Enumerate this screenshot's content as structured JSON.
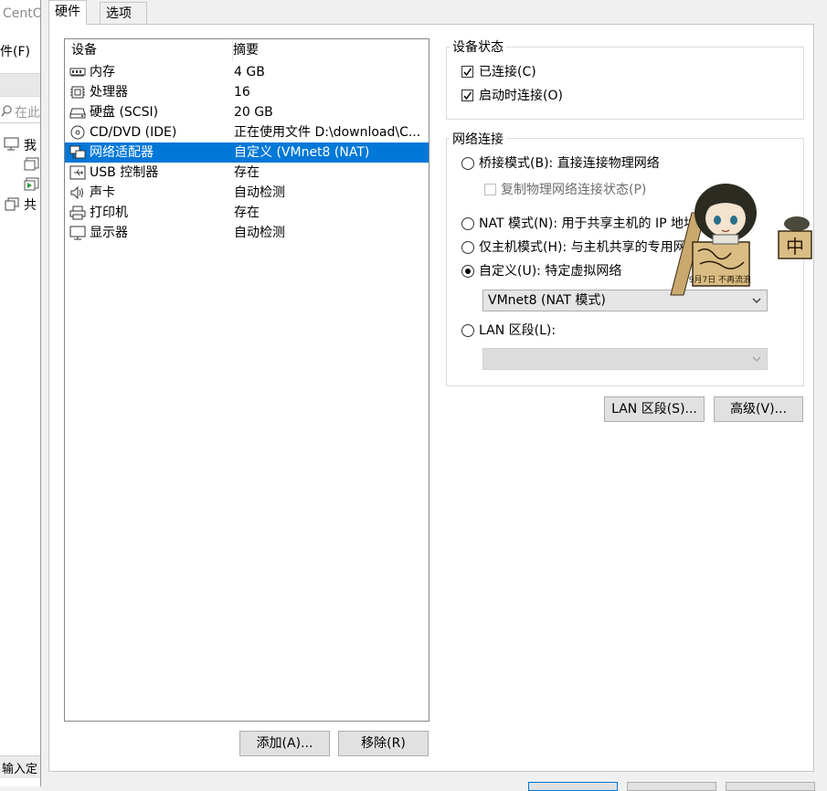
{
  "background_app": {
    "title_fragment": "CentO",
    "menu_fragment": "件(F)",
    "search_fragment": "在此",
    "tree": [
      {
        "label": "我"
      },
      {
        "label": ""
      },
      {
        "label": ""
      },
      {
        "label": "共"
      }
    ],
    "status_fragment": "输入定"
  },
  "tabs": [
    {
      "label": "硬件",
      "active": true
    },
    {
      "label": "选项",
      "active": false
    }
  ],
  "device_table": {
    "columns": [
      "设备",
      "摘要"
    ],
    "rows": [
      {
        "icon": "memory-icon",
        "device": "内存",
        "summary": "4 GB",
        "selected": false
      },
      {
        "icon": "processor-icon",
        "device": "处理器",
        "summary": "16",
        "selected": false
      },
      {
        "icon": "harddisk-icon",
        "device": "硬盘 (SCSI)",
        "summary": "20 GB",
        "selected": false
      },
      {
        "icon": "cd-dvd-icon",
        "device": "CD/DVD (IDE)",
        "summary": "正在使用文件 D:\\download\\C...",
        "selected": false
      },
      {
        "icon": "network-adapter-icon",
        "device": "网络适配器",
        "summary": "自定义 (VMnet8 (NAT)",
        "selected": true
      },
      {
        "icon": "usb-icon",
        "device": "USB 控制器",
        "summary": "存在",
        "selected": false
      },
      {
        "icon": "sound-icon",
        "device": "声卡",
        "summary": "自动检测",
        "selected": false
      },
      {
        "icon": "printer-icon",
        "device": "打印机",
        "summary": "存在",
        "selected": false
      },
      {
        "icon": "display-icon",
        "device": "显示器",
        "summary": "自动检测",
        "selected": false
      }
    ]
  },
  "list_buttons": {
    "add": "添加(A)...",
    "remove": "移除(R)"
  },
  "device_status": {
    "title": "设备状态",
    "connected": {
      "label": "已连接(C)",
      "checked": true
    },
    "connect_at_poweron": {
      "label": "启动时连接(O)",
      "checked": true
    }
  },
  "network": {
    "title": "网络连接",
    "bridged": {
      "label": "桥接模式(B): 直接连接物理网络",
      "selected": false
    },
    "replicate": {
      "label": "复制物理网络连接状态(P)",
      "checked": false,
      "disabled": true
    },
    "nat": {
      "label": "NAT 模式(N): 用于共享主机的 IP 地址",
      "selected": false
    },
    "hostonly": {
      "label": "仅主机模式(H): 与主机共享的专用网络",
      "selected": false
    },
    "custom": {
      "label": "自定义(U): 特定虚拟网络",
      "selected": true
    },
    "custom_select": "VMnet8 (NAT 模式)",
    "lan": {
      "label": "LAN 区段(L):",
      "selected": false
    },
    "lan_select": ""
  },
  "bottom_buttons": {
    "lan_segments": "LAN 区段(S)...",
    "advanced": "高级(V)..."
  },
  "sticker": {
    "badge_char": "中",
    "sign_text": "9月7日 不再流浪"
  },
  "colors": {
    "selection": "#0078d7",
    "sticker_board": "#c9a96e"
  }
}
